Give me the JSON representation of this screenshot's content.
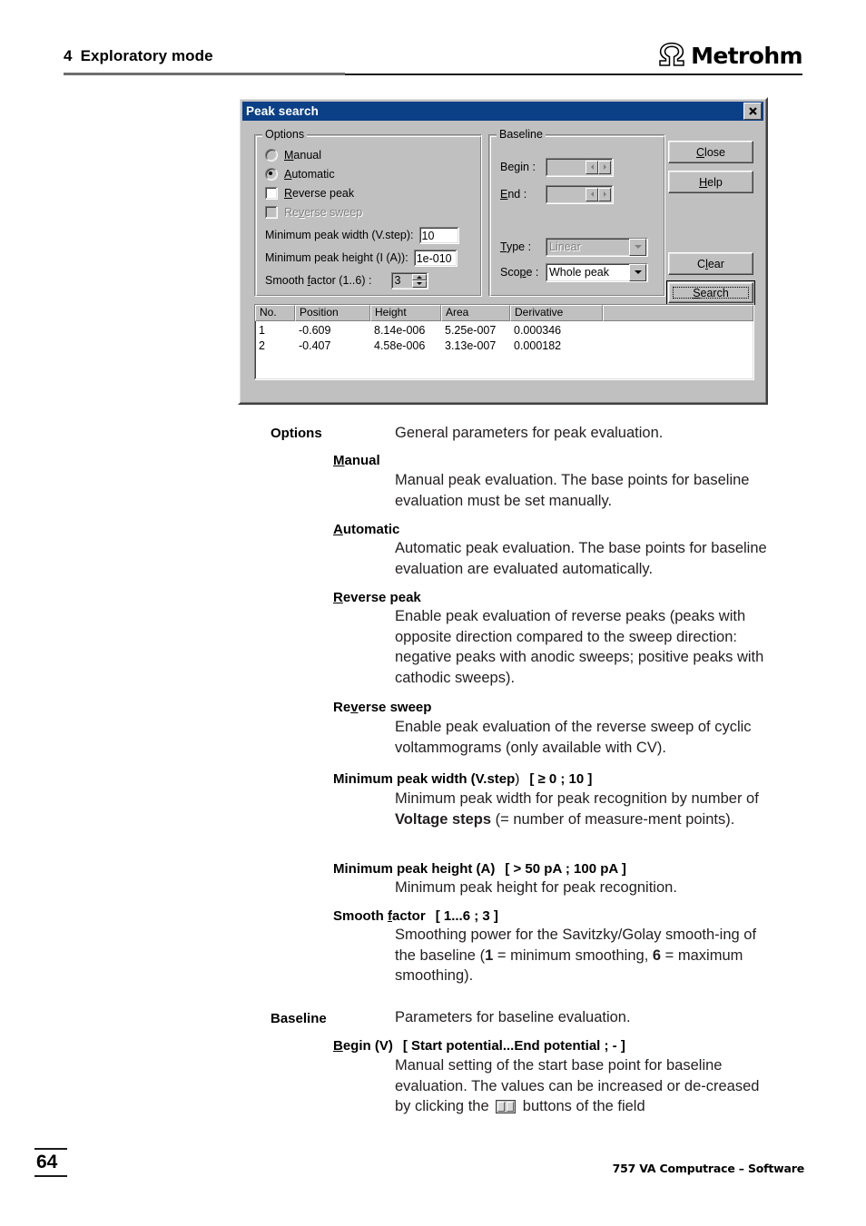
{
  "header": {
    "chapter_number": "4",
    "chapter_title": "Exploratory mode",
    "brand_name": "Metrohm",
    "brand_mark": "omega-logo-icon"
  },
  "dialog": {
    "title": "Peak search",
    "close_glyph": "✖",
    "options_group": {
      "legend": "Options",
      "radios": [
        {
          "label_pre": "",
          "acc": "M",
          "label_post": "anual",
          "selected": false,
          "disabled": false,
          "name": "manual"
        },
        {
          "label_pre": "",
          "acc": "A",
          "label_post": "utomatic",
          "selected": true,
          "disabled": false,
          "name": "automatic"
        }
      ],
      "checkboxes": [
        {
          "label_pre": "",
          "acc": "R",
          "label_post": "everse peak",
          "checked": false,
          "disabled": false,
          "name": "reverse-peak"
        },
        {
          "label_pre": "Re",
          "acc": "v",
          "label_post": "erse sweep",
          "checked": false,
          "disabled": true,
          "name": "reverse-sweep"
        }
      ],
      "fields": [
        {
          "label": "Minimum peak width (V.step):",
          "value": "10",
          "name": "minimum-peak-width"
        },
        {
          "label": "Minimum peak height (I (A)):",
          "value": "1e-010",
          "name": "minimum-peak-height"
        }
      ],
      "smooth": {
        "label_pre": "Smooth ",
        "acc": "f",
        "label_post": "actor (1..6) :",
        "value": "3",
        "name": "smooth-factor"
      }
    },
    "baseline_group": {
      "legend": "Baseline",
      "begin": {
        "acc": "g",
        "label_pre": "Be",
        "label_post": "in :",
        "value": ""
      },
      "end": {
        "acc": "E",
        "label_pre": "",
        "label_post": "nd :",
        "value": ""
      },
      "type": {
        "acc": "T",
        "label_pre": "",
        "label_post": "ype :",
        "value": "Linear",
        "disabled": true
      },
      "scope": {
        "acc": "p",
        "label_pre": "Sco",
        "label_post": "e :",
        "value": "Whole peak",
        "disabled": false
      }
    },
    "buttons": [
      {
        "name": "close-button",
        "label_pre": "",
        "acc": "C",
        "label_post": "lose",
        "default": false
      },
      {
        "name": "help-button",
        "label_pre": "",
        "acc": "H",
        "label_post": "elp",
        "default": false
      },
      {
        "name": "clear-button",
        "label_pre": "C",
        "acc": "l",
        "label_post": "ear",
        "default": false
      },
      {
        "name": "search-button",
        "label_pre": "",
        "acc": "S",
        "label_post": "earch",
        "default": true
      }
    ],
    "results": {
      "columns": [
        "No.",
        "Position",
        "Height",
        "Area",
        "Derivative",
        ""
      ],
      "rows": [
        [
          "1",
          "-0.609",
          "8.14e-006",
          "5.25e-007",
          "0.000346",
          ""
        ],
        [
          "2",
          "-0.407",
          "4.58e-006",
          "3.13e-007",
          "0.000182",
          ""
        ]
      ]
    }
  },
  "body": {
    "options": {
      "term": "Options",
      "desc": "General parameters for peak evaluation."
    },
    "manual": {
      "term_pre": "",
      "term_acc": "M",
      "term_post": "anual",
      "desc": "Manual peak evaluation. The base points for baseline evaluation must be set manually."
    },
    "automatic": {
      "term_pre": "",
      "term_acc": "A",
      "term_post": "utomatic",
      "desc": "Automatic peak evaluation. The base points for baseline evaluation are evaluated automatically."
    },
    "reverse_peak": {
      "term_pre": "",
      "term_acc": "R",
      "term_post": "everse peak",
      "desc": "Enable peak evaluation of reverse peaks (peaks with opposite direction compared to the sweep direction: negative peaks with anodic sweeps; positive peaks with cathodic sweeps)."
    },
    "reverse_sweep": {
      "term_pre": "Re",
      "term_acc": "v",
      "term_post": "erse sweep",
      "desc": "Enable peak evaluation of the reverse sweep of cyclic voltammograms (only available with CV)."
    },
    "min_peak_width": {
      "term": "Minimum peak width (V.step",
      "term_tail": ")",
      "range": "[ ≥ 0 ; 10 ]",
      "desc_1": "Minimum peak width for peak recognition by number of ",
      "desc_bold": "Voltage steps",
      "desc_2": " (= number of measure-ment points)."
    },
    "min_peak_height": {
      "term": "Minimum peak height (A)",
      "range": "[ > 50 pA ; 100 pA ]",
      "desc": "Minimum peak height for peak recognition."
    },
    "smooth_factor": {
      "term_pre": "Smooth ",
      "term_acc": "f",
      "term_post": "actor",
      "range": "[ 1...6 ; 3 ]",
      "desc_1": "Smoothing power for the Savitzky/Golay smooth-ing of the baseline (",
      "desc_b1": "1",
      "desc_2": " = minimum smoothing, ",
      "desc_b2": "6",
      "desc_3": " = maximum smoothing)."
    },
    "baseline": {
      "term": "Baseline",
      "desc": "Parameters for baseline evaluation."
    },
    "begin_v": {
      "term_pre": "",
      "term_acc": "B",
      "term_post": "egin (V)",
      "range": "[ Start potential...End potential ; - ]",
      "desc_1": "Manual setting of the start base point for baseline evaluation. The values can be increased or de-creased by clicking the ",
      "icon": "horizontal-spin-buttons-icon",
      "desc_2": " buttons of the field"
    }
  },
  "footer": {
    "page_number": "64",
    "document_title": "757 VA Computrace – Software"
  }
}
